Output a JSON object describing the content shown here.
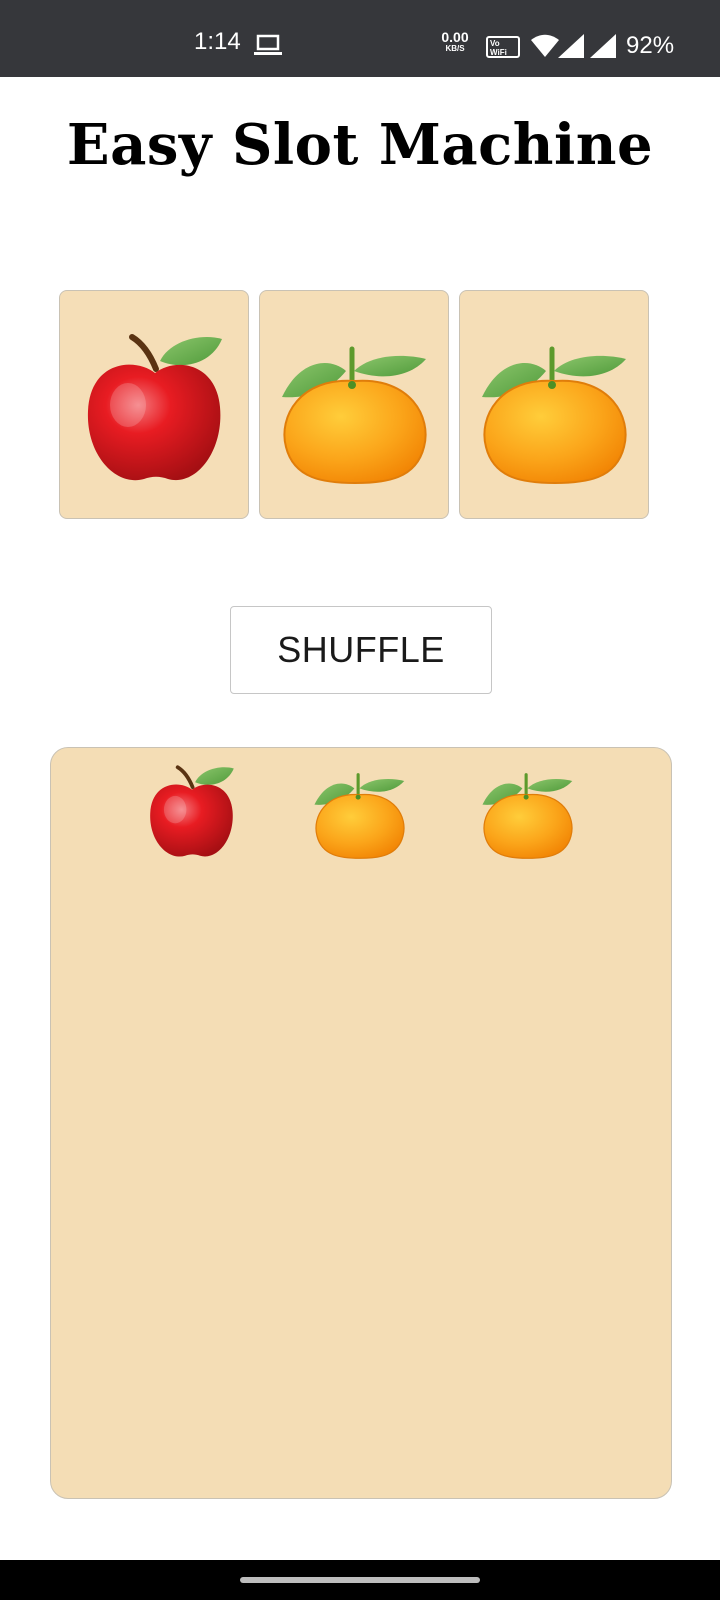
{
  "status_bar": {
    "time": "1:14",
    "net_speed_value": "0.00",
    "net_speed_unit": "KB/S",
    "vowifi_top": "Vo",
    "vowifi_bottom": "WiFi",
    "battery": "92%"
  },
  "app": {
    "title": "Easy Slot Machine",
    "shuffle_label": "SHUFFLE"
  },
  "slots": [
    {
      "icon": "apple-icon"
    },
    {
      "icon": "orange-icon"
    },
    {
      "icon": "orange-icon"
    }
  ],
  "history": [
    [
      "apple-icon",
      "orange-icon",
      "orange-icon"
    ]
  ],
  "colors": {
    "status_bar_bg": "#36373b",
    "card_bg": "#f5deb7",
    "panel_bg": "#f4ddb5",
    "apple_red": "#e0151b",
    "orange": "#f9a21a",
    "leaf_green": "#6cae4c"
  }
}
